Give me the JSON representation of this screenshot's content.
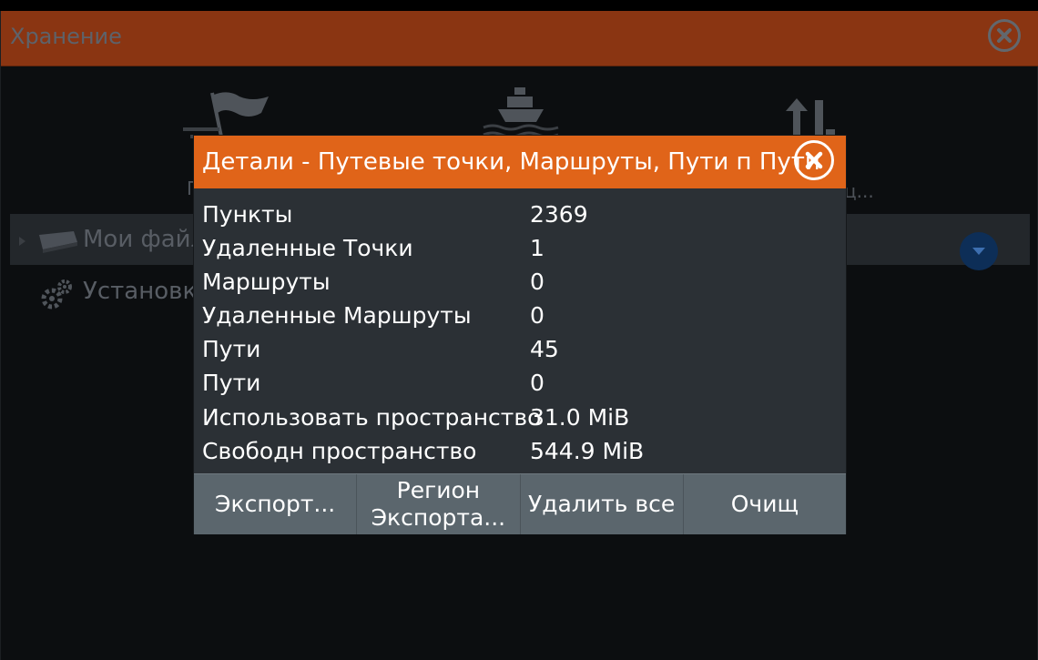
{
  "window": {
    "title": "Хранение",
    "close_icon": "close-circle-icon"
  },
  "toolbar": {
    "items": [
      {
        "icon": "waypoint-flag-icon",
        "label": "П"
      },
      {
        "icon": "vessel-icon",
        "label": ""
      },
      {
        "icon": "transfer-arrows-icon",
        "label": "ц..."
      }
    ]
  },
  "tree": {
    "my_files": "Мои файл",
    "settings": "Установки"
  },
  "dialog": {
    "title": "Детали - Путевые точки, Маршруты, Пути п Пути",
    "rows": [
      {
        "label": "Пункты",
        "value": "2369"
      },
      {
        "label": "Удаленные Точки",
        "value": "1"
      },
      {
        "label": "Маршруты",
        "value": "0"
      },
      {
        "label": "Удаленные Маршруты",
        "value": "0"
      },
      {
        "label": "Пути",
        "value": "45"
      },
      {
        "label": "Пути",
        "value": "0"
      },
      {
        "label": "Использовать пространство",
        "value": "31.0 MiB"
      },
      {
        "label": "Свободн  пространство",
        "value": "544.9 MiB"
      }
    ],
    "buttons": [
      {
        "label": "Экспорт..."
      },
      {
        "label": "Регион\nЭкспорта..."
      },
      {
        "label": "Удалить все"
      },
      {
        "label": "Очищ"
      }
    ]
  },
  "colors": {
    "dialog_header": "#e06419",
    "dialog_body": "#2b3035",
    "footer": "#5b666d",
    "background": "#0c0e10",
    "dropdown_accent": "#0d2e57"
  }
}
